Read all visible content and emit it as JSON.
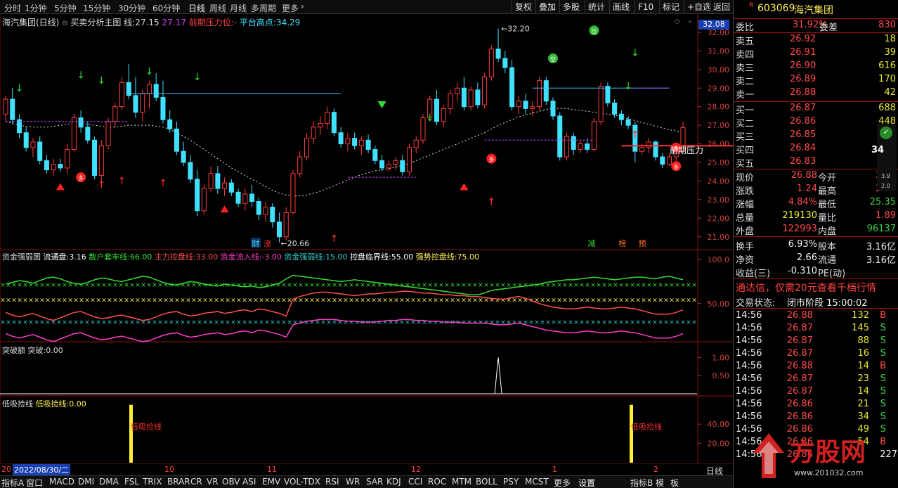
{
  "toolbar": {
    "timeframes": [
      "分时",
      "1分钟",
      "5分钟",
      "15分钟",
      "30分钟",
      "60分钟",
      "日线",
      "周线",
      "月线",
      "多周期",
      "更多"
    ],
    "active_timeframe": "日线",
    "buttons": [
      "复权",
      "叠加",
      "多股",
      "统计",
      "画线",
      "F10",
      "标记",
      "+自选",
      "返回"
    ]
  },
  "main_legend": {
    "stock": "海汽集团(日线)",
    "indicator": "买卖分析主图",
    "line_label": "线:",
    "line_value": "27.15",
    "v2": "27.17",
    "resistance_label": "前期压力位:",
    "resistance_value": "-",
    "platform_label": "平台高点:",
    "platform_value": "34.29"
  },
  "price_axis": {
    "ticks": [
      "32.00",
      "31.00",
      "30.00",
      "29.00",
      "28.00",
      "27.00",
      "26.00",
      "25.00",
      "24.00",
      "23.00",
      "22.00",
      "21.00"
    ],
    "current_tag": "32.08"
  },
  "annotations": {
    "high": "32.20",
    "low": "20.66",
    "resistance": "前期压力",
    "cai": "财",
    "zhang": "涨",
    "jian": "减",
    "bang": "榜",
    "yu": "预",
    "duo": "多",
    "kong": "空"
  },
  "ind1": {
    "title": "资金强弱图",
    "items": [
      {
        "label": "流通盘:",
        "value": "3.16",
        "color": "#ffffff"
      },
      {
        "label": "散户套牢线:",
        "value": "66.00",
        "color": "#33dd33"
      },
      {
        "label": "主力控盘线:",
        "value": "33.00",
        "color": "#ff5050"
      },
      {
        "label": "资金流入线:",
        "value": "-3.00",
        "color": "#ff3cc8"
      },
      {
        "label": "资金强弱线:",
        "value": "15.00",
        "color": "#33cccc"
      },
      {
        "label": "控盘临界线:",
        "value": "55.00",
        "color": "#ffffff"
      },
      {
        "label": "强势控盘线:",
        "value": "75.00",
        "color": "#ffee55"
      }
    ],
    "ticks": [
      "100.0",
      "50.00"
    ]
  },
  "ind2": {
    "title": "突破额",
    "label": "突破:",
    "value": "0.00",
    "ticks": [
      "1.00",
      "0.50"
    ]
  },
  "ind3": {
    "title": "低吸捡线",
    "label": "低吸捡线:",
    "value": "0.00",
    "ticks": [
      "40.00",
      "20.00"
    ],
    "marker_text": "低吸捡线"
  },
  "date_axis": {
    "start": "2022/08/30/二",
    "labels": [
      "10",
      "11",
      "12",
      "1",
      "2"
    ],
    "left_label": "20",
    "period": "日线"
  },
  "bottom_tabs": [
    "指标A",
    "窗口",
    "MACD",
    "DMI",
    "DMA",
    "FSL",
    "TRIX",
    "BRAR",
    "CR",
    "VR",
    "OBV",
    "ASI",
    "EMV",
    "VOL-TDX",
    "RSI",
    "WR",
    "SAR",
    "KDJ",
    "CCI",
    "ROC",
    "MTM",
    "BOLL",
    "PSY",
    "MCST",
    "更多",
    "设置",
    "指标B",
    "模",
    "板"
  ],
  "quote": {
    "code": "603069",
    "name": "海汽集团",
    "r_badge": "R",
    "weibi_label": "委比",
    "weibi": "31.92%",
    "weicha_label": "委差",
    "weicha": "830",
    "asks": [
      {
        "label": "卖五",
        "price": "26.92",
        "vol": "18"
      },
      {
        "label": "卖四",
        "price": "26.91",
        "vol": "39"
      },
      {
        "label": "卖三",
        "price": "26.90",
        "vol": "616"
      },
      {
        "label": "卖二",
        "price": "26.89",
        "vol": "170"
      },
      {
        "label": "卖一",
        "price": "26.88",
        "vol": "42"
      }
    ],
    "bids": [
      {
        "label": "买一",
        "price": "26.87",
        "vol": "688"
      },
      {
        "label": "买二",
        "price": "26.86",
        "vol": "448"
      },
      {
        "label": "买三",
        "price": "26.85",
        "vol": "81"
      },
      {
        "label": "买四",
        "price": "26.84",
        "vol": "59"
      },
      {
        "label": "买五",
        "price": "26.83",
        "vol": "239"
      }
    ],
    "stats": [
      {
        "l1": "现价",
        "v1": "26.88",
        "l2": "今开",
        "v2": "25.5"
      },
      {
        "l1": "涨跌",
        "v1": "1.24",
        "l2": "最高",
        "v2": "27.2"
      },
      {
        "l1": "涨幅",
        "v1": "4.84%",
        "l2": "最低",
        "v2": "25.35"
      },
      {
        "l1": "总量",
        "v1": "219130",
        "l2": "量比",
        "v2": "1.89"
      },
      {
        "l1": "外盘",
        "v1": "122993",
        "l2": "内盘",
        "v2": "96137"
      }
    ],
    "stats2": [
      {
        "l1": "换手",
        "v1": "6.93%",
        "l2": "股本",
        "v2": "3.16亿"
      },
      {
        "l1": "净资",
        "v1": "2.66",
        "l2": "流通",
        "v2": "3.16亿"
      },
      {
        "l1": "收益(三)",
        "v1": "-0.310",
        "l2": "PE(动)",
        "v2": ""
      }
    ],
    "ad": "通达信，仅需20元查看千档行情",
    "status_label": "交易状态:",
    "status": "闭市阶段 15:00:02",
    "widget": {
      "top": "34",
      "mid": "3.9",
      "bottom": "2.0"
    },
    "ticks": [
      {
        "t": "14:56",
        "p": "26.88",
        "v": "132",
        "s": "B"
      },
      {
        "t": "14:56",
        "p": "26.87",
        "v": "145",
        "s": "S"
      },
      {
        "t": "14:56",
        "p": "26.87",
        "v": "88",
        "s": "S"
      },
      {
        "t": "14:56",
        "p": "26.87",
        "v": "16",
        "s": "S"
      },
      {
        "t": "14:56",
        "p": "26.88",
        "v": "14",
        "s": "B"
      },
      {
        "t": "14:56",
        "p": "26.87",
        "v": "23",
        "s": "S"
      },
      {
        "t": "14:56",
        "p": "26.87",
        "v": "14",
        "s": "S"
      },
      {
        "t": "14:56",
        "p": "26.86",
        "v": "21",
        "s": "S"
      },
      {
        "t": "14:56",
        "p": "26.86",
        "v": "34",
        "s": "S"
      },
      {
        "t": "14:56",
        "p": "26.86",
        "v": "49",
        "s": "S"
      },
      {
        "t": "14:56",
        "p": "26.86",
        "v": "54",
        "s": "B"
      },
      {
        "t": "14:56",
        "p": "26.86",
        "v": "",
        "s": ""
      }
    ],
    "last_row_right": "227"
  },
  "watermark": {
    "text": "方股网",
    "url": "www.201032.com"
  },
  "colors": {
    "up": "#ff3c3c",
    "down": "#40e0ff",
    "grid": "#7a1010",
    "bg": "#000000"
  },
  "chart_data": {
    "type": "candlestick",
    "ylim": [
      20.5,
      32.3
    ],
    "ma_label": "线",
    "candles": [
      [
        27.6,
        28.6,
        27.2,
        28.4
      ],
      [
        28.4,
        29.0,
        27.1,
        27.3
      ],
      [
        27.3,
        27.6,
        26.3,
        26.6
      ],
      [
        26.6,
        26.9,
        25.6,
        25.8
      ],
      [
        25.8,
        26.3,
        25.3,
        26.1
      ],
      [
        26.1,
        26.4,
        24.9,
        25.1
      ],
      [
        25.1,
        25.4,
        24.4,
        24.6
      ],
      [
        24.6,
        25.2,
        24.3,
        24.9
      ],
      [
        24.9,
        25.2,
        24.5,
        24.7
      ],
      [
        24.7,
        26.0,
        24.4,
        25.7
      ],
      [
        25.7,
        27.6,
        25.6,
        27.4
      ],
      [
        27.4,
        27.8,
        26.6,
        26.9
      ],
      [
        26.9,
        27.2,
        26.0,
        26.2
      ],
      [
        26.2,
        26.4,
        24.1,
        24.3
      ],
      [
        24.3,
        26.2,
        24.0,
        25.9
      ],
      [
        25.9,
        27.4,
        25.7,
        27.2
      ],
      [
        27.2,
        28.2,
        26.9,
        28.0
      ],
      [
        28.0,
        29.6,
        27.8,
        29.3
      ],
      [
        29.3,
        30.3,
        28.4,
        28.6
      ],
      [
        28.6,
        29.6,
        27.4,
        27.7
      ],
      [
        27.7,
        28.9,
        27.2,
        28.7
      ],
      [
        28.7,
        29.4,
        27.9,
        29.2
      ],
      [
        29.2,
        29.8,
        28.3,
        28.5
      ],
      [
        28.5,
        29.4,
        27.1,
        27.3
      ],
      [
        27.3,
        27.8,
        26.6,
        26.8
      ],
      [
        26.8,
        27.2,
        25.4,
        25.6
      ],
      [
        25.6,
        26.1,
        24.8,
        25.0
      ],
      [
        25.0,
        25.4,
        23.9,
        24.1
      ],
      [
        24.1,
        24.6,
        22.1,
        22.4
      ],
      [
        22.4,
        23.8,
        22.2,
        23.6
      ],
      [
        23.6,
        24.8,
        23.4,
        24.4
      ],
      [
        24.4,
        24.8,
        23.3,
        23.6
      ],
      [
        23.6,
        24.2,
        23.2,
        23.9
      ],
      [
        23.9,
        24.1,
        23.2,
        23.4
      ],
      [
        23.4,
        23.6,
        22.6,
        22.8
      ],
      [
        22.8,
        23.6,
        22.4,
        23.3
      ],
      [
        23.3,
        23.8,
        22.6,
        22.9
      ],
      [
        22.9,
        23.1,
        21.9,
        22.2
      ],
      [
        22.2,
        22.9,
        21.8,
        22.6
      ],
      [
        22.6,
        22.8,
        21.5,
        21.8
      ],
      [
        21.8,
        22.3,
        20.7,
        21.0
      ],
      [
        21.0,
        22.6,
        20.8,
        22.3
      ],
      [
        22.3,
        24.6,
        22.2,
        24.4
      ],
      [
        24.4,
        25.6,
        24.2,
        25.3
      ],
      [
        25.3,
        26.6,
        25.1,
        26.3
      ],
      [
        26.3,
        27.2,
        26.0,
        26.9
      ],
      [
        26.9,
        27.5,
        26.5,
        27.1
      ],
      [
        27.1,
        28.0,
        26.8,
        27.7
      ],
      [
        27.7,
        27.9,
        26.4,
        26.6
      ],
      [
        26.6,
        26.9,
        25.8,
        26.0
      ],
      [
        26.0,
        26.6,
        25.6,
        26.3
      ],
      [
        26.3,
        26.6,
        25.7,
        25.9
      ],
      [
        25.9,
        26.4,
        25.4,
        26.2
      ],
      [
        26.2,
        26.5,
        25.5,
        25.7
      ],
      [
        25.7,
        25.9,
        24.9,
        25.1
      ],
      [
        25.1,
        25.4,
        24.5,
        24.7
      ],
      [
        24.7,
        25.1,
        24.5,
        24.9
      ],
      [
        24.9,
        25.3,
        24.6,
        25.1
      ],
      [
        25.1,
        25.4,
        24.3,
        24.5
      ],
      [
        24.5,
        26.0,
        24.3,
        25.8
      ],
      [
        25.8,
        26.4,
        25.5,
        26.2
      ],
      [
        26.2,
        27.6,
        26.0,
        27.4
      ],
      [
        27.4,
        28.6,
        27.2,
        28.4
      ],
      [
        28.4,
        28.9,
        27.0,
        27.2
      ],
      [
        27.2,
        28.1,
        26.9,
        27.9
      ],
      [
        27.9,
        28.9,
        27.6,
        28.7
      ],
      [
        28.7,
        29.3,
        28.3,
        29.0
      ],
      [
        29.0,
        29.6,
        27.8,
        28.0
      ],
      [
        28.0,
        29.1,
        27.8,
        28.9
      ],
      [
        28.9,
        29.3,
        27.9,
        28.1
      ],
      [
        28.1,
        29.8,
        27.9,
        29.6
      ],
      [
        29.6,
        31.3,
        29.4,
        31.1
      ],
      [
        31.1,
        32.2,
        30.4,
        30.6
      ],
      [
        30.6,
        31.0,
        29.8,
        30.1
      ],
      [
        30.1,
        30.5,
        27.8,
        28.0
      ],
      [
        28.0,
        28.6,
        27.6,
        28.3
      ],
      [
        28.3,
        28.7,
        27.6,
        27.9
      ],
      [
        27.9,
        28.3,
        27.5,
        28.0
      ],
      [
        28.0,
        29.6,
        27.8,
        29.4
      ],
      [
        29.4,
        29.6,
        28.1,
        28.3
      ],
      [
        28.3,
        28.5,
        27.3,
        27.5
      ],
      [
        27.5,
        27.7,
        25.1,
        25.3
      ],
      [
        25.3,
        26.6,
        25.1,
        26.4
      ],
      [
        26.4,
        26.6,
        25.4,
        25.7
      ],
      [
        25.7,
        26.2,
        25.5,
        26.0
      ],
      [
        26.0,
        26.3,
        25.5,
        25.7
      ],
      [
        25.7,
        27.4,
        25.6,
        27.2
      ],
      [
        27.2,
        29.3,
        27.0,
        29.1
      ],
      [
        29.1,
        29.3,
        28.0,
        28.2
      ],
      [
        28.2,
        28.4,
        27.4,
        27.6
      ],
      [
        27.6,
        27.8,
        27.0,
        27.3
      ],
      [
        27.3,
        27.5,
        26.8,
        27.0
      ],
      [
        27.0,
        27.2,
        25.0,
        25.6
      ],
      [
        25.6,
        26.0,
        25.4,
        25.8
      ],
      [
        25.8,
        26.3,
        25.5,
        26.1
      ],
      [
        26.1,
        26.2,
        25.1,
        25.3
      ],
      [
        25.3,
        25.5,
        24.7,
        24.9
      ],
      [
        24.9,
        25.5,
        24.8,
        25.3
      ],
      [
        25.3,
        25.8,
        25.0,
        25.6
      ],
      [
        25.6,
        27.2,
        25.5,
        26.88
      ]
    ],
    "ma": [
      27.2,
      27.1,
      27.0,
      26.95,
      26.9,
      26.9,
      26.9,
      26.95,
      27.0,
      27.05,
      27.1,
      27.1,
      27.05,
      27.0,
      26.95,
      26.9,
      26.9,
      26.95,
      27.0,
      27.0,
      27.0,
      27.0,
      26.95,
      26.9,
      26.8,
      26.6,
      26.4,
      26.2,
      25.95,
      25.7,
      25.45,
      25.2,
      24.95,
      24.7,
      24.5,
      24.3,
      24.1,
      23.9,
      23.7,
      23.5,
      23.35,
      23.25,
      23.2,
      23.2,
      23.25,
      23.35,
      23.45,
      23.6,
      23.75,
      23.9,
      24.05,
      24.2,
      24.35,
      24.45,
      24.55,
      24.6,
      24.65,
      24.75,
      24.85,
      24.95,
      25.1,
      25.25,
      25.4,
      25.55,
      25.7,
      25.85,
      26.0,
      26.15,
      26.3,
      26.45,
      26.6,
      26.8,
      27.0,
      27.15,
      27.3,
      27.45,
      27.55,
      27.65,
      27.75,
      27.85,
      27.9,
      27.9,
      27.9,
      27.85,
      27.8,
      27.75,
      27.7,
      27.65,
      27.6,
      27.55,
      27.45,
      27.35,
      27.25,
      27.15,
      27.05,
      26.95,
      26.85,
      26.75,
      26.7,
      26.6
    ],
    "ind1": {
      "green": [
        72,
        74,
        76,
        75,
        73,
        76,
        79,
        80,
        78,
        75,
        73,
        72,
        74,
        77,
        79,
        78,
        76,
        75,
        77,
        79,
        81,
        80,
        77,
        74,
        72,
        71,
        73,
        75,
        74,
        72,
        71,
        70,
        72,
        71,
        70,
        69,
        70,
        68,
        69,
        71,
        73,
        78,
        82,
        81,
        80,
        79,
        78,
        77,
        76,
        75,
        76,
        77,
        76,
        75,
        74,
        73,
        72,
        71,
        70,
        69,
        68,
        67,
        66,
        65,
        64,
        63,
        62,
        61,
        60,
        60,
        62,
        65,
        66,
        67,
        68,
        69,
        70,
        71,
        72,
        74,
        75,
        76,
        77,
        77,
        78,
        79,
        80,
        79,
        78,
        77,
        78,
        79,
        80,
        80,
        79,
        78,
        80,
        81,
        79,
        77
      ],
      "red": [
        40,
        37,
        35,
        37,
        39,
        36,
        33,
        31,
        34,
        37,
        40,
        41,
        38,
        35,
        33,
        34,
        36,
        37,
        35,
        33,
        31,
        32,
        35,
        38,
        40,
        41,
        38,
        36,
        37,
        39,
        40,
        41,
        39,
        40,
        42,
        43,
        41,
        44,
        43,
        41,
        39,
        36,
        55,
        58,
        60,
        62,
        63,
        63,
        62,
        61,
        60,
        59,
        60,
        61,
        61,
        62,
        63,
        63,
        64,
        64,
        63,
        62,
        62,
        61,
        60,
        60,
        59,
        59,
        58,
        58,
        57,
        56,
        55,
        55,
        57,
        58,
        56,
        53,
        50,
        48,
        46,
        45,
        44,
        44,
        45,
        46,
        45,
        44,
        44,
        45,
        46,
        45,
        44,
        42,
        40,
        38,
        38,
        38,
        40,
        43
      ],
      "magenta": [
        16,
        13,
        11,
        13,
        15,
        12,
        9,
        7,
        10,
        13,
        16,
        17,
        14,
        11,
        9,
        10,
        12,
        13,
        11,
        9,
        7,
        8,
        11,
        14,
        16,
        17,
        14,
        12,
        13,
        15,
        16,
        17,
        15,
        16,
        18,
        19,
        17,
        20,
        19,
        17,
        15,
        12,
        26,
        28,
        30,
        31,
        32,
        32,
        32,
        31,
        30,
        30,
        29,
        29,
        29,
        30,
        31,
        31,
        32,
        32,
        31,
        31,
        30,
        30,
        29,
        29,
        29,
        28,
        28,
        28,
        28,
        27,
        26,
        26,
        27,
        28,
        26,
        24,
        22,
        20,
        19,
        18,
        17,
        17,
        18,
        19,
        18,
        17,
        17,
        18,
        19,
        18,
        17,
        15,
        13,
        11,
        11,
        11,
        13,
        16
      ],
      "levels": [
        66,
        55,
        33,
        75
      ]
    },
    "ind2": {
      "spike_index": 72,
      "max": 1.0
    },
    "ind3": {
      "bars": [
        12,
        91
      ],
      "value": 60
    }
  }
}
